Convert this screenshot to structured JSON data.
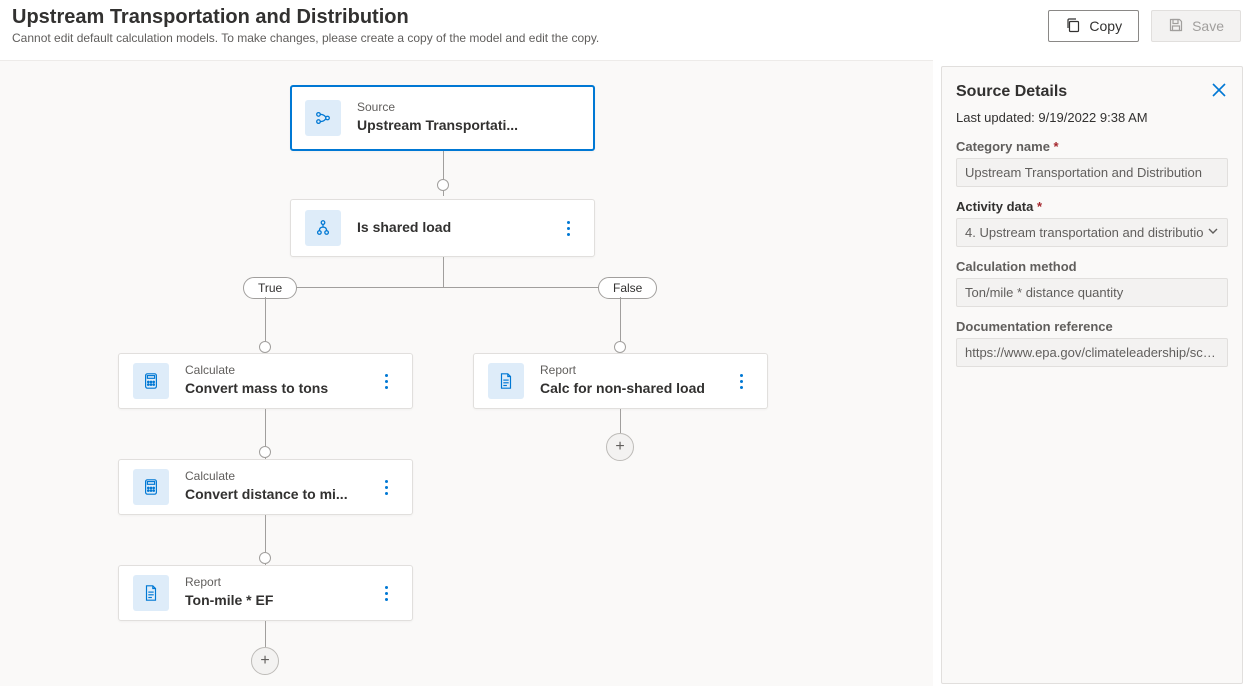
{
  "header": {
    "title": "Upstream Transportation and Distribution",
    "subtitle": "Cannot edit default calculation models. To make changes, please create a copy of the model and edit the copy.",
    "copy_label": "Copy",
    "save_label": "Save"
  },
  "flow": {
    "source": {
      "type_label": "Source",
      "title": "Upstream Transportati..."
    },
    "decision": {
      "title": "Is shared load"
    },
    "true_label": "True",
    "false_label": "False",
    "true_branch": [
      {
        "type_label": "Calculate",
        "title": "Convert mass to tons"
      },
      {
        "type_label": "Calculate",
        "title": "Convert distance to mi..."
      },
      {
        "type_label": "Report",
        "title": "Ton-mile * EF"
      }
    ],
    "false_branch": [
      {
        "type_label": "Report",
        "title": "Calc for non-shared load"
      }
    ]
  },
  "panel": {
    "title": "Source Details",
    "last_updated_label": "Last updated:",
    "last_updated_value": "9/19/2022 9:38 AM",
    "category_label": "Category name",
    "category_value": "Upstream Transportation and Distribution",
    "activity_label": "Activity data",
    "activity_value": "4. Upstream transportation and distributio",
    "method_label": "Calculation method",
    "method_value": "Ton/mile * distance quantity",
    "doc_label": "Documentation reference",
    "doc_value": "https://www.epa.gov/climateleadership/sco..."
  }
}
